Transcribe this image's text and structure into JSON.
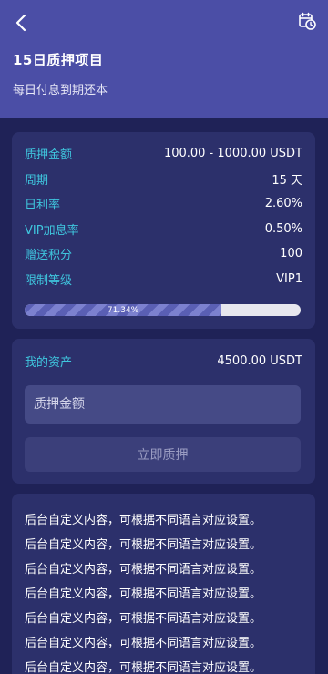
{
  "header": {
    "title": "15日质押项目",
    "subtitle": "每日付息到期还本"
  },
  "info": {
    "rows": [
      {
        "label": "质押金额",
        "value": "100.00 - 1000.00 USDT"
      },
      {
        "label": "周期",
        "value": "15 天"
      },
      {
        "label": "日利率",
        "value": "2.60%"
      },
      {
        "label": "VIP加息率",
        "value": "0.50%"
      },
      {
        "label": "赠送积分",
        "value": "100"
      },
      {
        "label": "限制等级",
        "value": "VIP1"
      }
    ],
    "progress": {
      "percent": 71.34,
      "label": "71.34%"
    }
  },
  "assets": {
    "label": "我的资产",
    "value": "4500.00 USDT",
    "input_placeholder": "质押金额",
    "button_label": "立即质押"
  },
  "content": {
    "lines": [
      "后台自定义内容，可根据不同语言对应设置。",
      "后台自定义内容，可根据不同语言对应设置。",
      "后台自定义内容，可根据不同语言对应设置。",
      "后台自定义内容，可根据不同语言对应设置。",
      "后台自定义内容，可根据不同语言对应设置。",
      "后台自定义内容，可根据不同语言对应设置。",
      "后台自定义内容，可根据不同语言对应设置。"
    ]
  },
  "icons": {
    "back": "chevron-left-icon",
    "history": "calendar-clock-icon"
  },
  "colors": {
    "header_bg": "#4b4ea6",
    "page_bg": "#1f2257",
    "card_bg": "#2c306b",
    "label_accent": "#3fc6de",
    "input_bg": "#454a86",
    "button_bg": "#3b3f7a"
  }
}
